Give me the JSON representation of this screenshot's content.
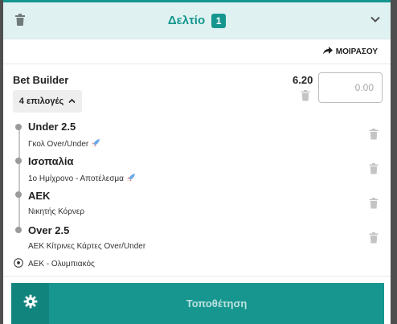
{
  "header": {
    "title": "Δελτίο",
    "badge": "1",
    "icons": {
      "clear": "trash-icon",
      "collapse": "chevron-down-icon"
    }
  },
  "share": {
    "label": "ΜΟΙΡΑΣΟΥ",
    "icon": "share-arrow-icon"
  },
  "bet": {
    "title": "Bet Builder",
    "options_label": "4 επιλογές",
    "odds": "6.20",
    "stake_placeholder": "0.00"
  },
  "selections": [
    {
      "title": "Under 2.5",
      "market": "Γκολ Over/Under",
      "boost": true
    },
    {
      "title": "Ισοπαλία",
      "market": "1ο Ημίχρονο - Αποτέλεσμα",
      "boost": true
    },
    {
      "title": "ΑΕΚ",
      "market": "Νικητής Κόρνερ",
      "boost": false
    },
    {
      "title": "Over 2.5",
      "market": "ΑΕΚ Κίτρινες Κάρτες Over/Under",
      "boost": false
    }
  ],
  "match": {
    "label": "ΑΕΚ - Ολυμπιακός",
    "icon": "football-icon"
  },
  "footer": {
    "place_label": "Τοποθέτηση",
    "settings_icon": "gear-icon"
  },
  "colors": {
    "accent": "#16968f",
    "header_bg": "#dff2f1",
    "dark_accent": "#12847e",
    "backdrop": "#4f4f4f"
  }
}
